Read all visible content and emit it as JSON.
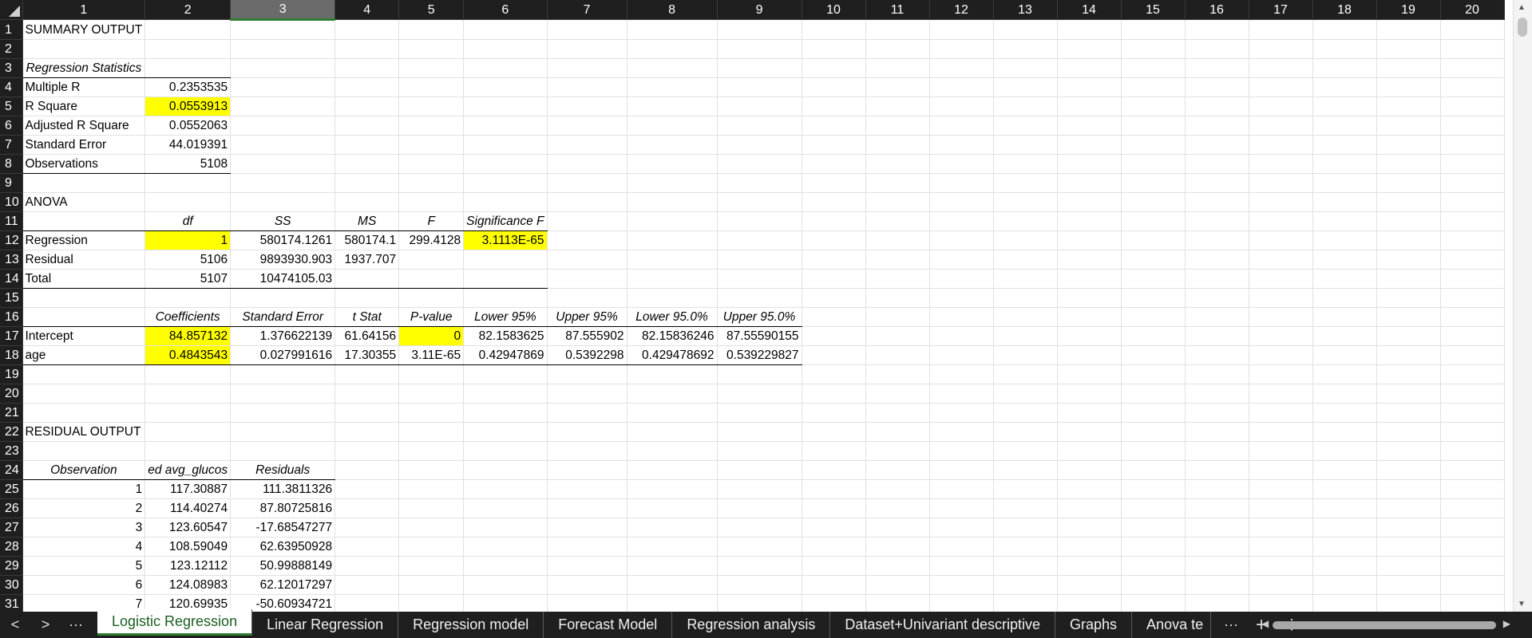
{
  "columns": [
    "1",
    "2",
    "3",
    "4",
    "5",
    "6",
    "7",
    "8",
    "9",
    "10",
    "11",
    "12",
    "13",
    "14",
    "15",
    "16",
    "17",
    "18",
    "19",
    "20"
  ],
  "selected_column": "3",
  "rows": [
    [
      "SUMMARY OUTPUT",
      "",
      "",
      "",
      "",
      "",
      "",
      "",
      ""
    ],
    [
      "",
      "",
      "",
      "",
      "",
      "",
      "",
      "",
      ""
    ],
    [
      "Regression Statistics",
      "",
      "",
      "",
      "",
      "",
      "",
      "",
      ""
    ],
    [
      "Multiple R",
      "0.2353535",
      "",
      "",
      "",
      "",
      "",
      "",
      ""
    ],
    [
      "R Square",
      "0.0553913",
      "",
      "",
      "",
      "",
      "",
      "",
      ""
    ],
    [
      "Adjusted R Square",
      "0.0552063",
      "",
      "",
      "",
      "",
      "",
      "",
      ""
    ],
    [
      "Standard Error",
      "44.019391",
      "",
      "",
      "",
      "",
      "",
      "",
      ""
    ],
    [
      "Observations",
      "5108",
      "",
      "",
      "",
      "",
      "",
      "",
      ""
    ],
    [
      "",
      "",
      "",
      "",
      "",
      "",
      "",
      "",
      ""
    ],
    [
      "ANOVA",
      "",
      "",
      "",
      "",
      "",
      "",
      "",
      ""
    ],
    [
      "",
      "df",
      "SS",
      "MS",
      "F",
      "Significance F",
      "",
      "",
      ""
    ],
    [
      "Regression",
      "1",
      "580174.1261",
      "580174.1",
      "299.4128",
      "3.1113E-65",
      "",
      "",
      ""
    ],
    [
      "Residual",
      "5106",
      "9893930.903",
      "1937.707",
      "",
      "",
      "",
      "",
      ""
    ],
    [
      "Total",
      "5107",
      "10474105.03",
      "",
      "",
      "",
      "",
      "",
      ""
    ],
    [
      "",
      "",
      "",
      "",
      "",
      "",
      "",
      "",
      ""
    ],
    [
      "",
      "Coefficients",
      "Standard Error",
      "t Stat",
      "P-value",
      "Lower 95%",
      "Upper 95%",
      "Lower 95.0%",
      "Upper 95.0%"
    ],
    [
      "Intercept",
      "84.857132",
      "1.376622139",
      "61.64156",
      "0",
      "82.1583625",
      "87.555902",
      "82.15836246",
      "87.55590155"
    ],
    [
      "age",
      "0.4843543",
      "0.027991616",
      "17.30355",
      "3.11E-65",
      "0.42947869",
      "0.5392298",
      "0.429478692",
      "0.539229827"
    ],
    [
      "",
      "",
      "",
      "",
      "",
      "",
      "",
      "",
      ""
    ],
    [
      "",
      "",
      "",
      "",
      "",
      "",
      "",
      "",
      ""
    ],
    [
      "",
      "",
      "",
      "",
      "",
      "",
      "",
      "",
      ""
    ],
    [
      "RESIDUAL OUTPUT",
      "",
      "",
      "",
      "",
      "",
      "",
      "",
      ""
    ],
    [
      "",
      "",
      "",
      "",
      "",
      "",
      "",
      "",
      ""
    ],
    [
      "Observation",
      "ed avg_glucos",
      "Residuals",
      "",
      "",
      "",
      "",
      "",
      ""
    ],
    [
      "1",
      "117.30887",
      "111.3811326",
      "",
      "",
      "",
      "",
      "",
      ""
    ],
    [
      "2",
      "114.40274",
      "87.80725816",
      "",
      "",
      "",
      "",
      "",
      ""
    ],
    [
      "3",
      "123.60547",
      "-17.68547277",
      "",
      "",
      "",
      "",
      "",
      ""
    ],
    [
      "4",
      "108.59049",
      "62.63950928",
      "",
      "",
      "",
      "",
      "",
      ""
    ],
    [
      "5",
      "123.12112",
      "50.99888149",
      "",
      "",
      "",
      "",
      "",
      ""
    ],
    [
      "6",
      "124.08983",
      "62.12017297",
      "",
      "",
      "",
      "",
      "",
      ""
    ],
    [
      "7",
      "120.69935",
      "-50.60934721",
      "",
      "",
      "",
      "",
      "",
      ""
    ]
  ],
  "tabs": [
    "Logistic Regression",
    "Linear Regression",
    "Regression model",
    "Forecast Model",
    "Regression analysis",
    "Dataset+Univariant descriptive",
    "Graphs",
    "Anova te"
  ],
  "active_tab": "Logistic Regression",
  "nav": {
    "prev": "<",
    "next": ">",
    "more": "···",
    "more_tabs": "···",
    "add": "+",
    "options": "⋮"
  },
  "colors": {
    "highlight": "#ffff00",
    "header_bg": "#1f1f1f",
    "active_tab": "#2e7d32"
  }
}
